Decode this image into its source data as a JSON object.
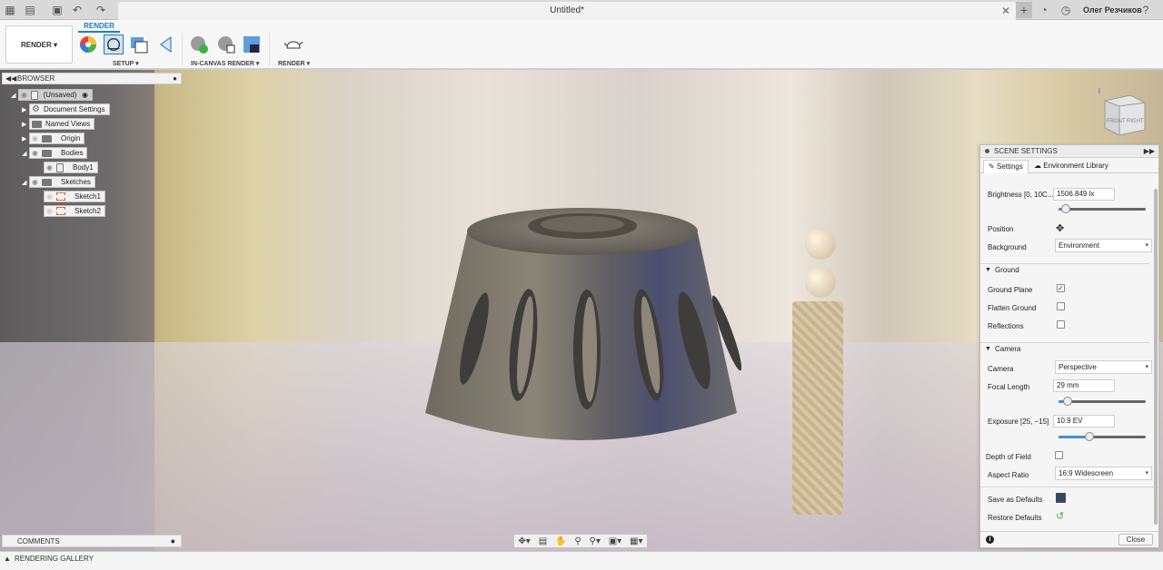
{
  "titlebar": {
    "document_title": "Untitled*",
    "user_name": "Олег Резчиков"
  },
  "ribbon": {
    "workspace_label": "RENDER",
    "active_tab": "RENDER",
    "groups": {
      "setup": "SETUP",
      "in_canvas": "IN-CANVAS RENDER",
      "render": "RENDER"
    }
  },
  "browser": {
    "title": "BROWSER",
    "root_label": "(Unsaved)",
    "items": [
      {
        "label": "Document Settings"
      },
      {
        "label": "Named Views"
      },
      {
        "label": "Origin"
      },
      {
        "label": "Bodies"
      },
      {
        "label": "Body1"
      },
      {
        "label": "Sketches"
      },
      {
        "label": "Sketch1"
      },
      {
        "label": "Sketch2"
      }
    ]
  },
  "comments": {
    "title": "COMMENTS"
  },
  "gallery": {
    "title": "RENDERING GALLERY"
  },
  "scene_settings": {
    "title": "SCENE SETTINGS",
    "tabs": {
      "settings": "Settings",
      "env_library": "Environment Library"
    },
    "brightness_label": "Brightness [0, 10C...",
    "brightness_value": "1506.849 lx",
    "brightness_level": 0.08,
    "position_label": "Position",
    "background_label": "Background",
    "background_value": "Environment",
    "ground_section": "Ground",
    "ground_plane_label": "Ground Plane",
    "ground_plane_checked": true,
    "flatten_ground_label": "Flatten Ground",
    "reflections_label": "Reflections",
    "camera_section": "Camera",
    "camera_label": "Camera",
    "camera_value": "Perspective",
    "focal_length_label": "Focal Length",
    "focal_length_value": "29 mm",
    "focal_level": 0.1,
    "exposure_label": "Exposure [25, −15]",
    "exposure_value": "10.9 EV",
    "exposure_level": 0.35,
    "dof_label": "Depth of Field",
    "aspect_label": "Aspect Ratio",
    "aspect_value": "16:9 Widescreen",
    "save_defaults_label": "Save as Defaults",
    "restore_defaults_label": "Restore Defaults",
    "close_label": "Close"
  },
  "viewcube": {
    "front": "FRONT",
    "right": "RIGHT"
  },
  "colors": {
    "accent": "#1c7fc3",
    "slider_fill": "#3f90d6"
  }
}
